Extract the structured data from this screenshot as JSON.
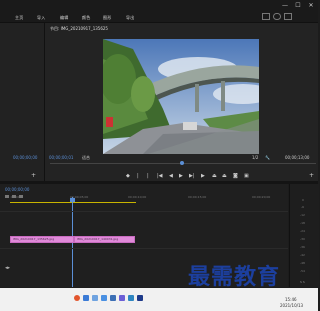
{
  "menubar": {
    "items": [
      "主页",
      "导入",
      "编辑",
      "颜色",
      "图形",
      "导出"
    ]
  },
  "window_controls": {
    "minimize": "—",
    "maximize": "☐",
    "close": "✕"
  },
  "program": {
    "title": "节目: IMG_20210917_135625",
    "timecode_left": "00;00;00;01",
    "fit": "适合",
    "page": "1/2",
    "timecode_right": "00;00;13;00"
  },
  "source": {
    "timecode": "00;00;00;00"
  },
  "timeline": {
    "timecode": "00;00;00;00",
    "ruler": [
      ":00;00",
      "00;00;05;00",
      "00;00;10;00",
      "00;00;15;00",
      "00;00;20;00",
      "00;00;25;00"
    ],
    "clips": [
      {
        "label": "IMG_20210917_135625.jpg"
      },
      {
        "label": "IMG_20210917_140031.jpg"
      }
    ],
    "meter_labels": [
      "0",
      "-6",
      "-12",
      "-18",
      "-24",
      "-30",
      "-36",
      "-42",
      "-48",
      "-54"
    ],
    "meter_footer": "S S"
  },
  "taskbar": {
    "time": "15:46",
    "date": "2021/10/13"
  },
  "watermark": "最需教育"
}
